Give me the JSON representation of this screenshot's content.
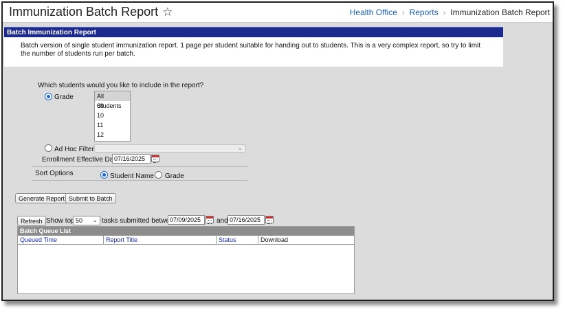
{
  "header": {
    "title": "Immunization Batch Report",
    "star_icon": "star-outline-icon",
    "breadcrumb": {
      "items": [
        "Health Office",
        "Reports"
      ],
      "current": "Immunization Batch Report",
      "separator": "›"
    }
  },
  "banner": {
    "title": "Batch Immunization Report"
  },
  "description": {
    "text": "Batch version of single student immunization report. 1 page per student suitable for handing out to students. This is a very complex report, so try to limit the number of students run per batch."
  },
  "form": {
    "question": "Which students would you like to include in the report?",
    "grade_label": "Grade",
    "grade_options": [
      "All Students",
      "09",
      "10",
      "11",
      "12"
    ],
    "grade_selected": "All Students",
    "adhoc_label": "Ad Hoc Filter",
    "adhoc_value": "",
    "enrollment_label": "Enrollment Effective Date",
    "enrollment_date": "07/16/2025",
    "sort_label": "Sort Options",
    "sort_student_name": "Student Name",
    "sort_grade": "Grade"
  },
  "actions": {
    "generate": "Generate Report",
    "submit": "Submit to Batch"
  },
  "queue_controls": {
    "refresh": "Refresh",
    "show_top": "Show top",
    "top_value": "50",
    "tasks_between": "tasks submitted between",
    "date_from": "07/09/2025",
    "and": "and",
    "date_to": "07/16/2025"
  },
  "queue": {
    "title": "Batch Queue List",
    "columns": [
      "Queued Time",
      "Report Title",
      "Status",
      "Download"
    ]
  },
  "colors": {
    "banner": "#1b2a8c",
    "link": "#1c5bb5",
    "radio_accent": "#1a63d6",
    "background": "#dcdcdc"
  }
}
